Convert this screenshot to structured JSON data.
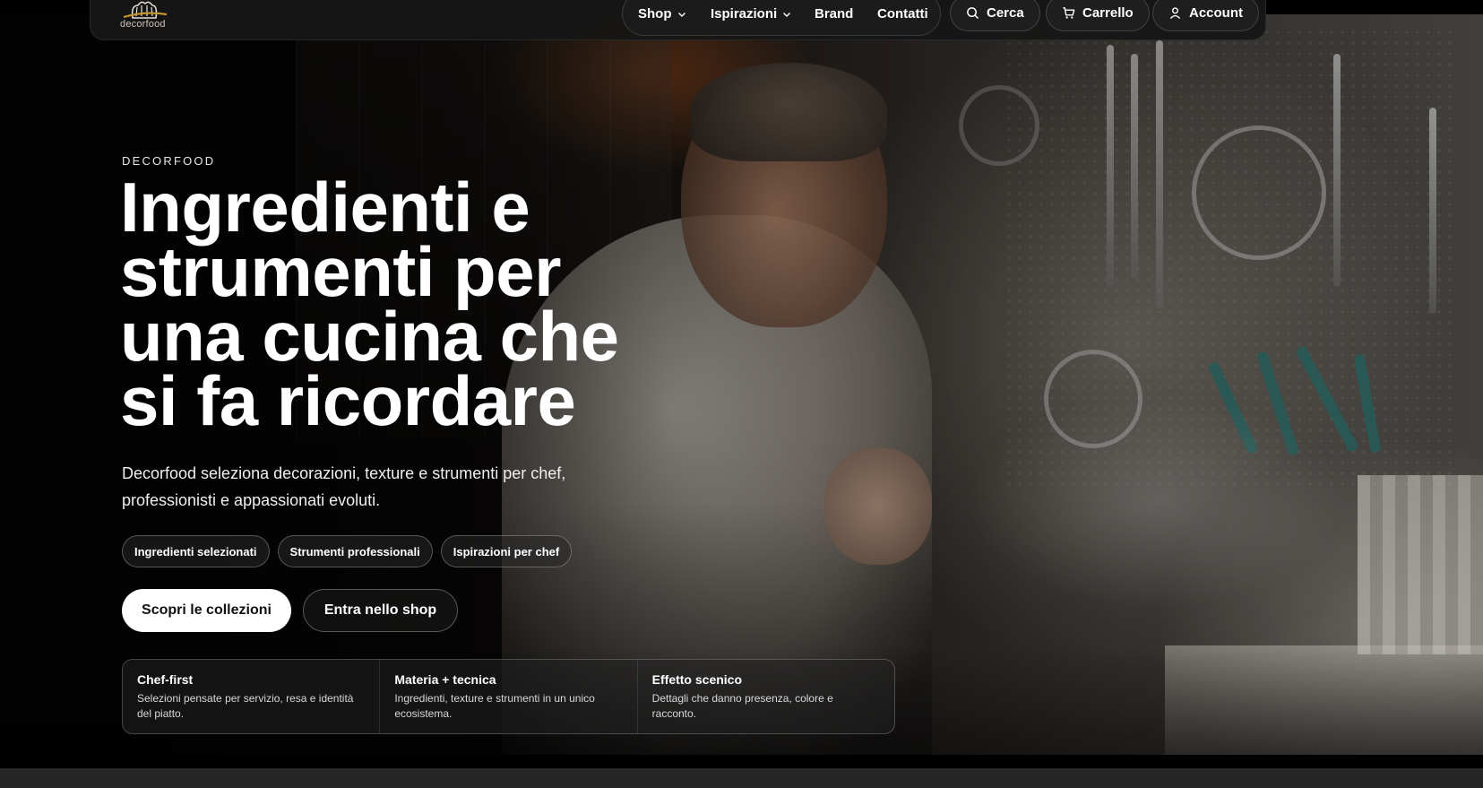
{
  "header": {
    "logo_text": "decorfood",
    "nav": {
      "shop": "Shop",
      "ispirazioni": "Ispirazioni",
      "brand": "Brand",
      "contatti": "Contatti"
    },
    "actions": {
      "search": "Cerca",
      "cart": "Carrello",
      "account": "Account"
    },
    "icons": {
      "search": "search-icon",
      "cart": "cart-icon",
      "account": "user-icon",
      "dropdown": "chevron-down-icon"
    }
  },
  "hero": {
    "eyebrow": "DECORFOOD",
    "headline": "Ingredienti e strumenti per una cucina che si fa ricordare",
    "subtitle": "Decorfood seleziona decorazioni, texture e strumenti per chef, professionisti e appassionati evoluti.",
    "chips": [
      "Ingredienti selezionati",
      "Strumenti professionali",
      "Ispirazioni per chef"
    ],
    "cta_primary": "Scopri le collezioni",
    "cta_secondary": "Entra nello shop",
    "features": [
      {
        "title": "Chef-first",
        "desc": "Selezioni pensate per servizio, resa e identità del piatto."
      },
      {
        "title": "Materia + tecnica",
        "desc": "Ingredienti, texture e strumenti in un unico ecosistema."
      },
      {
        "title": "Effetto scenico",
        "desc": "Dettagli che danno presenza, colore e racconto."
      }
    ]
  },
  "colors": {
    "page_background": "#0b0b0b",
    "header_background": "#161616",
    "primary_button": "#ffffff",
    "primary_button_text": "#111111",
    "logo_accent": "#c8962e"
  }
}
